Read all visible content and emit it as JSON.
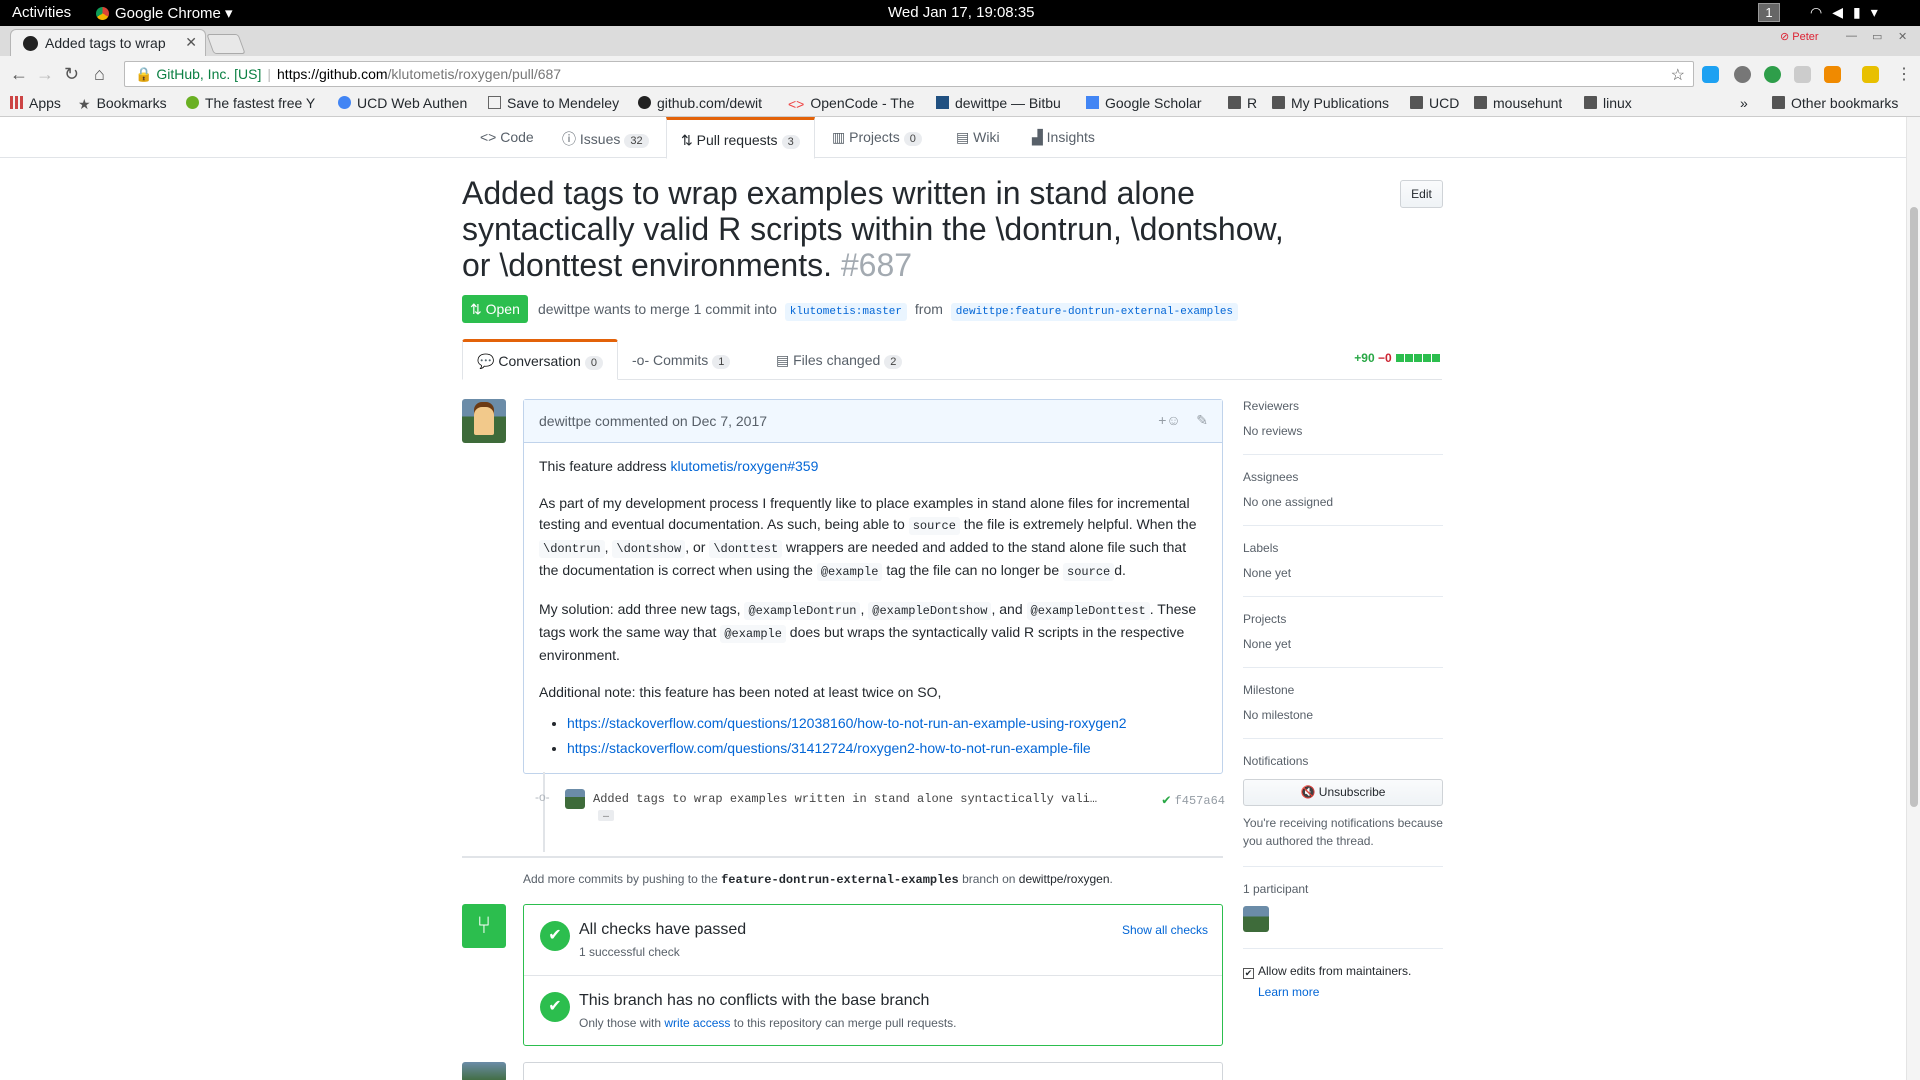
{
  "os": {
    "activities": "Activities",
    "app": "Google Chrome ▾",
    "clock": "Wed Jan 17, 19:08:35",
    "workspace": "1"
  },
  "browser": {
    "tab_title": "Added tags to wrap",
    "profile": "Peter",
    "secure_label": "GitHub, Inc. [US]",
    "url_host": "https://github.com",
    "url_path": "/klutometis/roxygen/pull/687",
    "bookmarks": [
      "Apps",
      "Bookmarks",
      "The fastest free Y",
      "UCD Web Authen",
      "Save to Mendeley",
      "github.com/dewit",
      "OpenCode - The",
      "dewittpe — Bitbu",
      "Google Scholar",
      "R",
      "My Publications",
      "UCD",
      "mousehunt",
      "linux"
    ],
    "other_bookmarks": "Other bookmarks"
  },
  "repo_nav": [
    {
      "label": "Code"
    },
    {
      "label": "Issues",
      "count": "32"
    },
    {
      "label": "Pull requests",
      "count": "3"
    },
    {
      "label": "Projects",
      "count": "0"
    },
    {
      "label": "Wiki"
    },
    {
      "label": "Insights"
    }
  ],
  "pr": {
    "title": "Added tags to wrap examples written in stand alone syntactically valid R scripts within the \\dontrun, \\dontshow, or \\donttest environments.",
    "number": "#687",
    "edit": "Edit",
    "state": "Open",
    "meta_prefix": "dewittpe wants to merge 1 commit into",
    "base": "klutometis:master",
    "from": "from",
    "head": "dewittpe:feature-dontrun-external-examples"
  },
  "pr_tabs": [
    {
      "label": "Conversation",
      "count": "0"
    },
    {
      "label": "Commits",
      "count": "1"
    },
    {
      "label": "Files changed",
      "count": "2"
    }
  ],
  "diffstat": {
    "add": "+90",
    "del": "−0"
  },
  "comment": {
    "header": "dewittpe commented on Dec 7, 2017",
    "p1_text": "This feature address ",
    "p1_link": "klutometis/roxygen#359",
    "p2a": "As part of my development process I frequently like to place examples in stand alone files for incremental testing and eventual documentation. As such, being able to ",
    "p2_code1": "source",
    "p2b": " the file is extremely helpful. When the ",
    "p2_code2": "\\dontrun",
    "p2_code3": "\\dontshow",
    "p2_code4": "\\donttest",
    "p2c": " wrappers are needed and added to the stand alone file such that the documentation is correct when using the ",
    "p2_code5": "@example",
    "p2d": " tag the file can no longer be ",
    "p2_code6": "source",
    "p2e": "d.",
    "p3a": "My solution: add three new tags, ",
    "p3_code1": "@exampleDontrun",
    "p3_code2": "@exampleDontshow",
    "p3_code3": "@exampleDonttest",
    "p3b": ". These tags work the same way that ",
    "p3_code4": "@example",
    "p3c": " does but wraps the syntactically valid R scripts in the respective environment.",
    "p4": "Additional note: this feature has been noted at least twice on SO,",
    "links": [
      "https://stackoverflow.com/questions/12038160/how-to-not-run-an-example-using-roxygen2",
      "https://stackoverflow.com/questions/31412724/roxygen2-how-to-not-run-example-file"
    ]
  },
  "commit": {
    "message": "Added tags to wrap examples written in stand alone syntactically vali…",
    "more": "…",
    "sha": "f457a64"
  },
  "add_more": {
    "a": "Add more commits by pushing to the ",
    "branch": "feature-dontrun-external-examples",
    "b": " branch on ",
    "repo": "dewittpe/roxygen",
    "c": "."
  },
  "merge": {
    "checks_title": "All checks have passed",
    "checks_sub": "1 successful check",
    "show_all": "Show all checks",
    "conflict_title": "This branch has no conflicts with the base branch",
    "conflict_sub_a": "Only those with ",
    "conflict_link": "write access",
    "conflict_sub_b": " to this repository can merge pull requests."
  },
  "sidebar": {
    "reviewers": {
      "label": "Reviewers",
      "value": "No reviews"
    },
    "assignees": {
      "label": "Assignees",
      "value": "No one assigned"
    },
    "labels": {
      "label": "Labels",
      "value": "None yet"
    },
    "projects": {
      "label": "Projects",
      "value": "None yet"
    },
    "milestone": {
      "label": "Milestone",
      "value": "No milestone"
    },
    "notifications": {
      "label": "Notifications",
      "button": "Unsubscribe",
      "note": "You're receiving notifications because you authored the thread."
    },
    "participants": "1 participant",
    "allow_edits": "Allow edits from maintainers.",
    "learn_more": "Learn more"
  },
  "colors": {
    "open_green": "#2cbe4e",
    "link_blue": "#0366d6",
    "tab_orange": "#e36209"
  }
}
